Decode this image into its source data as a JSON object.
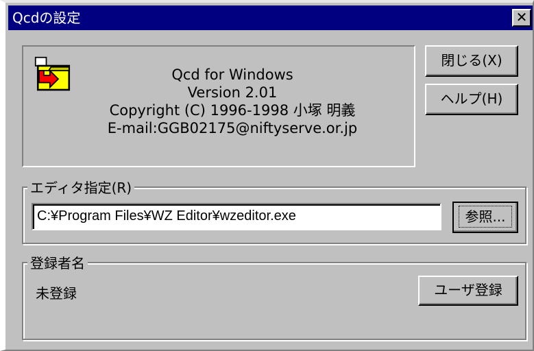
{
  "window": {
    "title": "Qcdの設定",
    "close_glyph": "✕"
  },
  "info": {
    "icon": "folder-arrow-icon",
    "product": "Qcd for Windows",
    "version": "Version 2.01",
    "copyright": "Copyright (C) 1996-1998 小塚 明義",
    "email": "E-mail:GGB02175@niftyserve.or.jp"
  },
  "buttons": {
    "close_label": "閉じる(X)",
    "help_label": "ヘルプ(H)",
    "browse_label": "参照...",
    "register_label": "ユーザ登録"
  },
  "editor": {
    "group_label": "エディタ指定(R)",
    "path": "C:¥Program Files¥WZ Editor¥wzeditor.exe"
  },
  "registration": {
    "group_label": "登録者名",
    "value": "未登録"
  },
  "colors": {
    "titlebar": "#000080",
    "face": "#c0c0c0",
    "icon_folder": "#ffff00",
    "icon_arrow": "#ff0000"
  }
}
